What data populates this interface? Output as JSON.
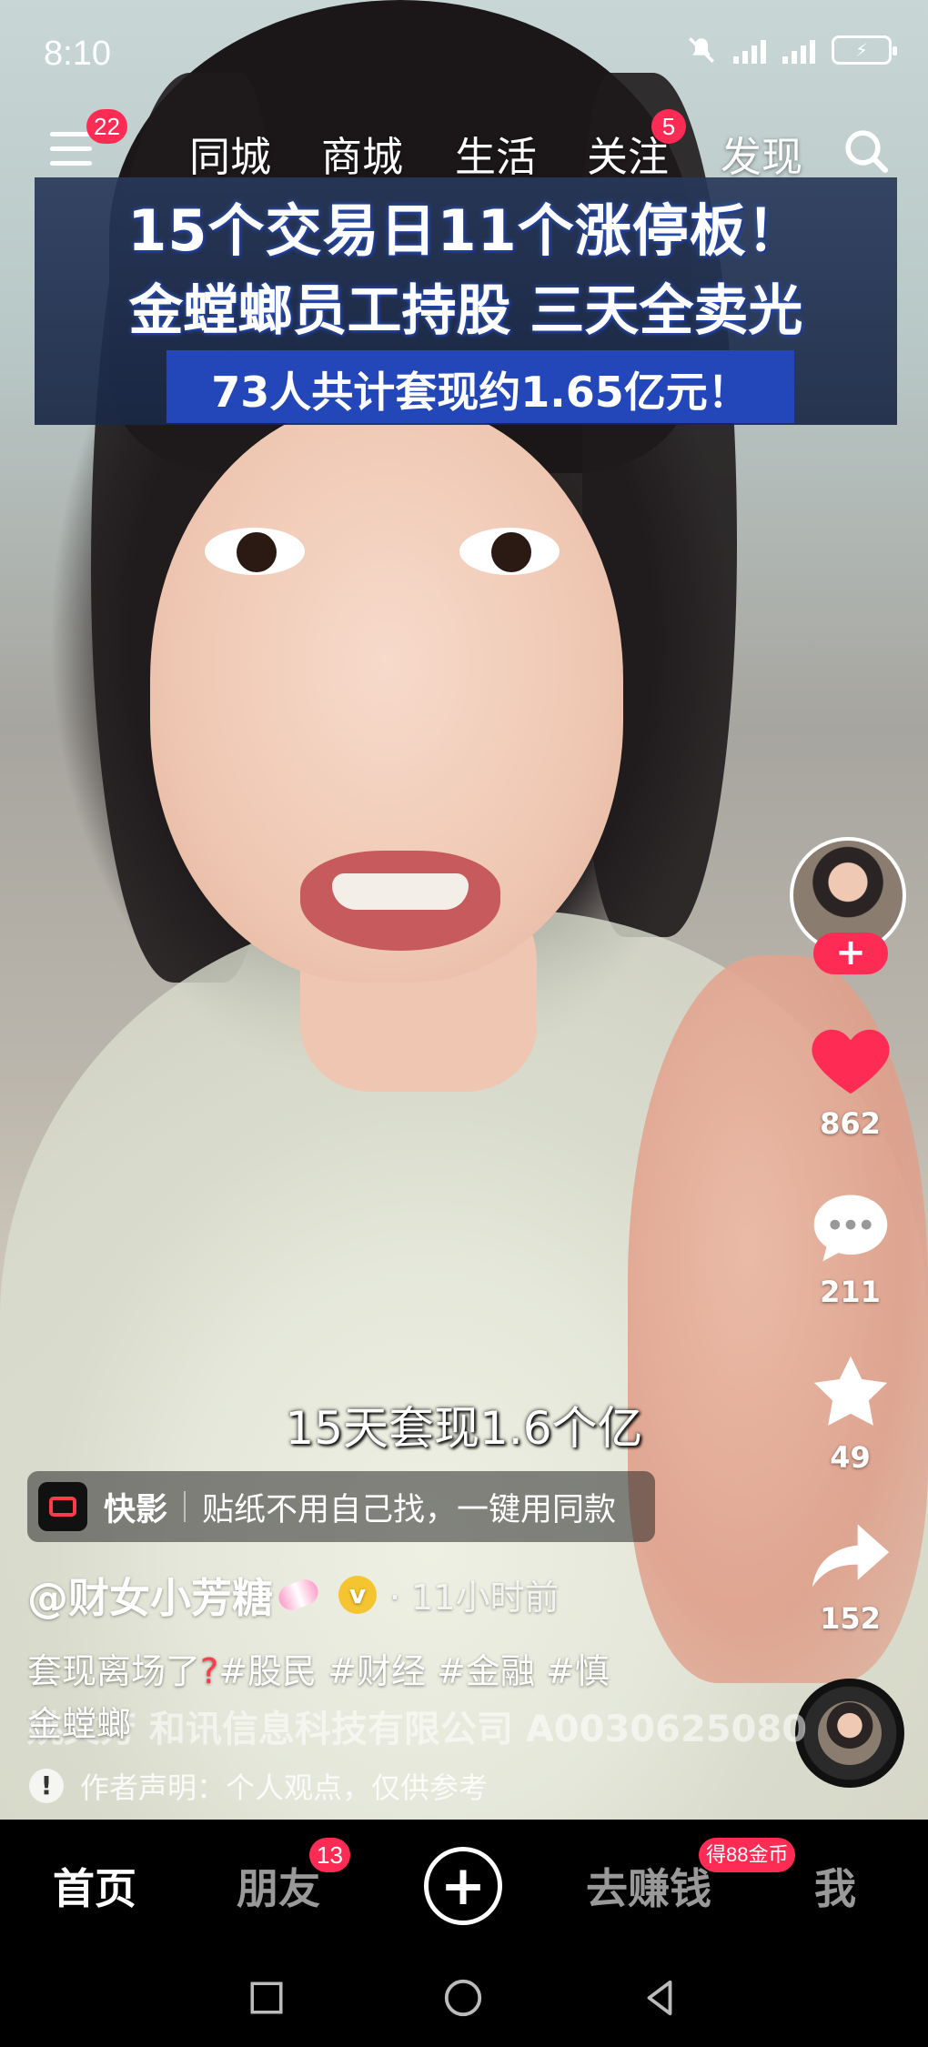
{
  "status_bar": {
    "time": "8:10",
    "icons": [
      "mute-icon",
      "signal-icon",
      "signal-icon",
      "battery-charging-icon"
    ]
  },
  "top_nav": {
    "menu_badge": "22",
    "tabs": [
      {
        "label": "同城"
      },
      {
        "label": "商城"
      },
      {
        "label": "生活"
      },
      {
        "label": "关注",
        "badge": "5"
      },
      {
        "label": "发现"
      }
    ]
  },
  "video": {
    "headline_line1": "15个交易日11个涨停板！",
    "headline_line2": "金螳螂员工持股 三天全卖光",
    "headline_line3": "73人共计套现约1.65亿元！",
    "subtitle": "15天套现1.6个亿"
  },
  "actions": {
    "likes": "862",
    "comments": "211",
    "favorites": "49",
    "shares": "152"
  },
  "kuaiying": {
    "name": "快影",
    "text": "贴纸不用自己找，一键用同款"
  },
  "author": {
    "name": "@财女小芳糖",
    "time_ago": "· 11小时前"
  },
  "description": {
    "line1_prefix": "套现离场了",
    "line1_rest": "#股民 #财经 #金融 #慎",
    "line2": "金螳螂",
    "overlay": "姚文芳 和讯信息科技有限公司 A0030625080"
  },
  "disclaimer": "作者声明：个人观点，仅供参考",
  "tabbar": {
    "home": "首页",
    "friends": "朋友",
    "friends_badge": "13",
    "earn": "去赚钱",
    "earn_badge": "得88金币",
    "me": "我"
  },
  "colors": {
    "accent": "#fe2c55",
    "like": "#fe2c55",
    "tabbar_bg": "#000000"
  }
}
